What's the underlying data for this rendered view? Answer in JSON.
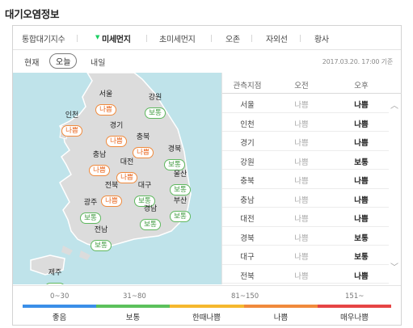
{
  "title": "대기오염정보",
  "tabs": [
    {
      "label": "통합대기지수",
      "active": false
    },
    {
      "label": "미세먼지",
      "active": true
    },
    {
      "label": "초미세먼지",
      "active": false
    },
    {
      "label": "오존",
      "active": false
    },
    {
      "label": "자외선",
      "active": false
    },
    {
      "label": "황사",
      "active": false
    }
  ],
  "days": [
    {
      "label": "현재",
      "active": false
    },
    {
      "label": "오늘",
      "active": true
    },
    {
      "label": "내일",
      "active": false
    }
  ],
  "timestamp": "2017.03.20. 17:00 기준",
  "map_regions": [
    {
      "name": "서울",
      "status": "나쁨",
      "level": "bad"
    },
    {
      "name": "강원",
      "status": "보통",
      "level": "normal"
    },
    {
      "name": "인천",
      "status": "나쁨",
      "level": "bad"
    },
    {
      "name": "경기",
      "status": "나쁨",
      "level": "bad"
    },
    {
      "name": "충북",
      "status": "나쁨",
      "level": "bad"
    },
    {
      "name": "충남",
      "status": "나쁨",
      "level": "bad"
    },
    {
      "name": "대전",
      "status": "나쁨",
      "level": "bad"
    },
    {
      "name": "경북",
      "status": "보통",
      "level": "normal"
    },
    {
      "name": "전북",
      "status": "나쁨",
      "level": "bad"
    },
    {
      "name": "대구",
      "status": "보통",
      "level": "normal"
    },
    {
      "name": "울산",
      "status": "보통",
      "level": "normal"
    },
    {
      "name": "광주",
      "status": "보통",
      "level": "normal"
    },
    {
      "name": "경남",
      "status": "보통",
      "level": "normal"
    },
    {
      "name": "부산",
      "status": "보통",
      "level": "normal"
    },
    {
      "name": "전남",
      "status": "보통",
      "level": "normal"
    },
    {
      "name": "제주",
      "status": "보통",
      "level": "normal"
    }
  ],
  "table": {
    "headers": [
      "관측지점",
      "오전",
      "오후"
    ],
    "rows": [
      {
        "station": "서울",
        "am": "나쁨",
        "pm": "나쁨"
      },
      {
        "station": "인천",
        "am": "나쁨",
        "pm": "나쁨"
      },
      {
        "station": "경기",
        "am": "나쁨",
        "pm": "나쁨"
      },
      {
        "station": "강원",
        "am": "나쁨",
        "pm": "보통"
      },
      {
        "station": "충북",
        "am": "나쁨",
        "pm": "나쁨"
      },
      {
        "station": "충남",
        "am": "나쁨",
        "pm": "나쁨"
      },
      {
        "station": "대전",
        "am": "나쁨",
        "pm": "나쁨"
      },
      {
        "station": "경북",
        "am": "나쁨",
        "pm": "보통"
      },
      {
        "station": "대구",
        "am": "나쁨",
        "pm": "보통"
      },
      {
        "station": "전북",
        "am": "나쁨",
        "pm": "나쁨"
      }
    ]
  },
  "legend": {
    "ranges": [
      "0~30",
      "31~80",
      "81~150",
      "151~"
    ],
    "levels": [
      {
        "label": "좋음",
        "color": "#3b8fe8"
      },
      {
        "label": "보통",
        "color": "#5cc15c"
      },
      {
        "label": "한때나쁨",
        "color": "#f5b82e"
      },
      {
        "label": "나쁨",
        "color": "#f08a3c"
      },
      {
        "label": "매우나쁨",
        "color": "#e64545"
      }
    ]
  },
  "colors": {
    "active_tab_marker": "#19ce60",
    "bad": "#e8641c",
    "normal": "#3f9a3f",
    "sea": "#bfe3ea",
    "land": "#dcdcdc"
  },
  "icons": {
    "scroll_up": "chevron-up-icon",
    "scroll_down": "chevron-down-icon",
    "active_tab": "triangle-down-icon"
  }
}
